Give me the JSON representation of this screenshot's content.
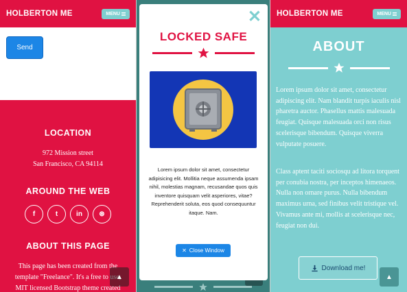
{
  "left": {
    "brand": "HOLBERTON ME",
    "menu_label": "MENU",
    "send_label": "Send",
    "location_heading": "LOCATION",
    "address_line1": "972 Mission street",
    "address_line2": "San Francisco, CA 94114",
    "web_heading": "AROUND THE WEB",
    "socials": [
      {
        "icon": "facebook-icon",
        "glyph": "f"
      },
      {
        "icon": "twitter-icon",
        "glyph": "t"
      },
      {
        "icon": "linkedin-icon",
        "glyph": "in"
      },
      {
        "icon": "dribbble-icon",
        "glyph": "⊛"
      }
    ],
    "about_heading": "ABOUT THIS PAGE",
    "about_line1": "This page has been created from the",
    "about_line2": "template \"Freelance\". It's a free to use,",
    "about_line3": "MIT licensed Bootstrap theme created"
  },
  "modal": {
    "title": "LOCKED SAFE",
    "body": "Lorem ipsum dolor sit amet, consectetur adipisicing elit. Mollitia neque assumenda ipsam nihil, molestias magnam, recusandae quos quis inventore quisquam velit asperiores, vitae? Reprehenderit soluta, eos quod consequuntur itaque. Nam.",
    "close_label": "Close Window"
  },
  "right": {
    "brand": "HOLBERTON ME",
    "menu_label": "MENU",
    "title": "ABOUT",
    "para1": "Lorem ipsum dolor sit amet, consectetur adipiscing elit. Nam blandit turpis iaculis nisl pharetra auctor. Phasellus mattis malesuada feugiat. Quisque malesuada orci non risus scelerisque bibendum. Quisque viverra vulputate posuere.",
    "para2": "Class aptent taciti sociosqu ad litora torquent per conubia nostra, per inceptos himenaeos. Nulla non ornare purus. Nulla bibendum maximus urna, sed finibus velit tristique vel. Vivamus ante mi, mollis at scelerisque nec, feugiat non dui.",
    "download_label": "Download me!"
  },
  "colors": {
    "red": "#e01242",
    "teal": "#7ecfd0",
    "blue": "#1c86e6",
    "dark_teal": "#3a7f7c"
  }
}
